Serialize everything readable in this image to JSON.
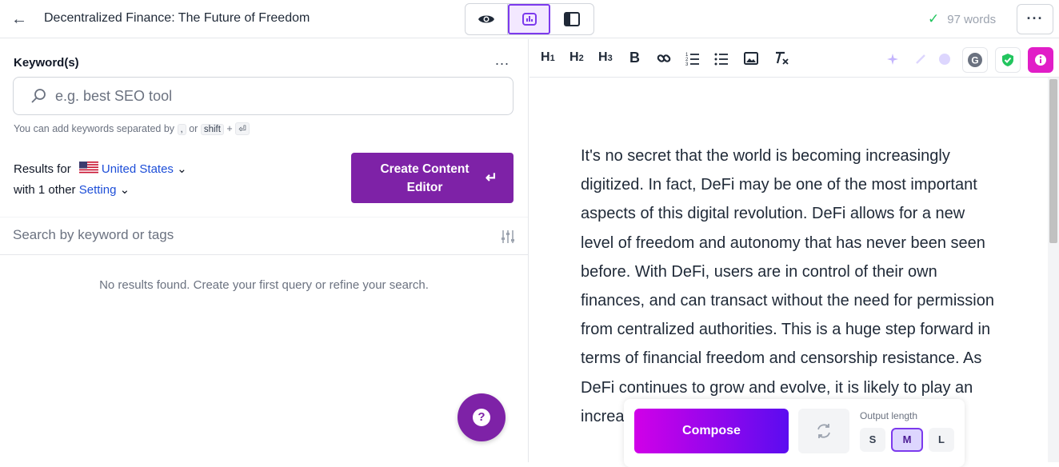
{
  "header": {
    "back_icon": "arrow-left-icon",
    "title": "Decentralized Finance: The Future of Freedom",
    "view_modes": [
      {
        "name": "preview",
        "icon": "eye-icon"
      },
      {
        "name": "analytics",
        "icon": "chart-box-icon",
        "active": true
      },
      {
        "name": "side-panel",
        "icon": "side-panel-icon"
      }
    ],
    "word_count": "97 words",
    "more_label": "···"
  },
  "keywords": {
    "label": "Keyword(s)",
    "menu_label": "...",
    "placeholder": "e.g. best SEO tool",
    "hint_prefix": "You can add keywords separated by",
    "hint_comma": ",",
    "hint_or": "or",
    "hint_shift": "shift",
    "hint_plus": "+",
    "hint_enter": "⏎"
  },
  "settings": {
    "results_for": "Results for",
    "country": "United States",
    "with_other": "with 1 other",
    "setting_link": "Setting",
    "create_button": "Create Content Editor",
    "create_enter": "↵"
  },
  "search": {
    "placeholder": "Search by keyword or tags",
    "empty_message": "No results found. Create your first query or refine your search."
  },
  "toolbar": {
    "h1": "H",
    "h2": "H",
    "h3": "H",
    "h1_sub": "1",
    "h2_sub": "2",
    "h3_sub": "3",
    "bold": "B"
  },
  "editor": {
    "text": "It's no secret that the world is becoming increasingly digitized. In fact, DeFi may be one of the most important aspects of this digital revolution. DeFi allows for a new level of freedom and autonomy that has never been seen before. With DeFi, users are in control of their own finances, and can transact without the need for permission from centralized authorities. This is a huge step forward in terms of financial freedom and censorship resistance. As DeFi continues to grow and evolve, it is likely to play an increa"
  },
  "compose": {
    "button": "Compose",
    "output_length_label": "Output length",
    "sizes": [
      "S",
      "M",
      "L"
    ],
    "selected_size": "M"
  },
  "colors": {
    "accent": "#7e22a7",
    "compose_start": "#d100e8",
    "compose_end": "#5b0cf0",
    "link": "#1d4ed8",
    "check": "#22c55e"
  }
}
